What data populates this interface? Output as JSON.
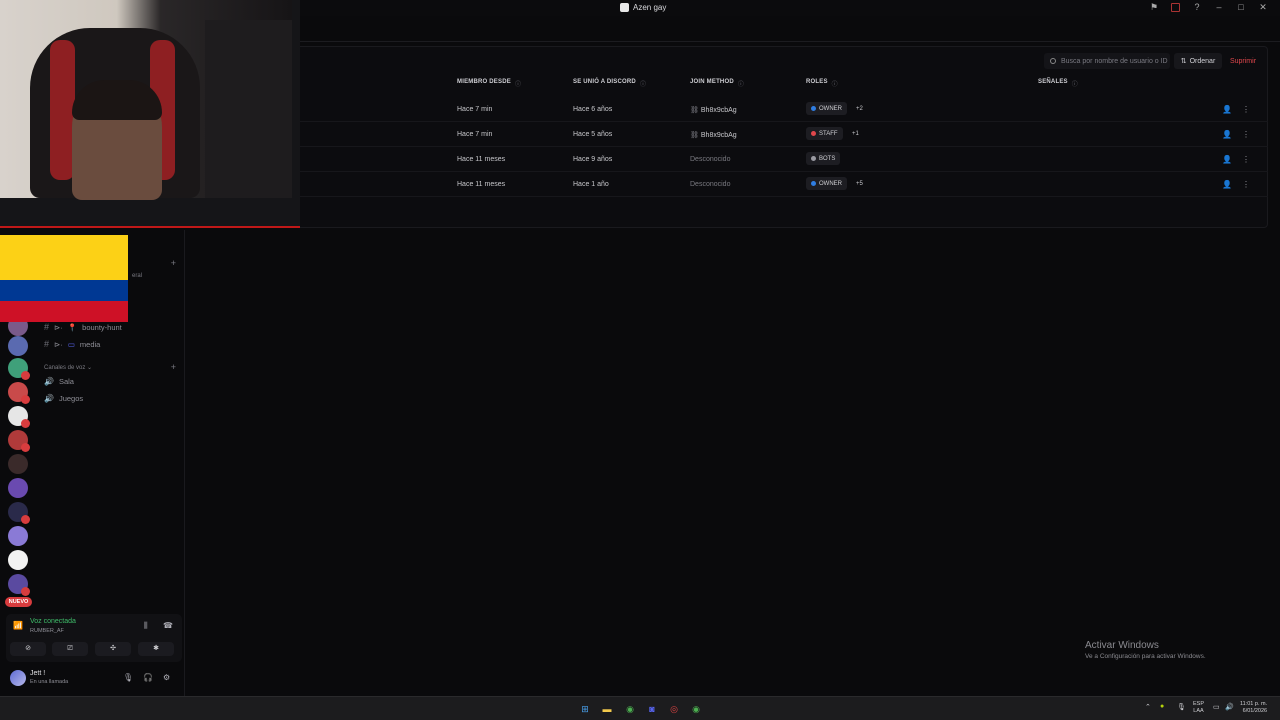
{
  "window": {
    "title": "Azen gay"
  },
  "toolbar": {
    "search_placeholder": "Busca por nombre de usuario o ID",
    "sort_label": "Ordenar",
    "delete_label": "Suprimir"
  },
  "table": {
    "headers": [
      "MIEMBRO DESDE",
      "SE UNIÓ A DISCORD",
      "JOIN METHOD",
      "ROLES",
      "SEÑALES"
    ],
    "rows": [
      {
        "member_since": "Hace 7 min",
        "joined_discord": "Hace 6 años",
        "join_method": "Bh8x9cbAg",
        "role": "OWNER",
        "role_color": "#2f7de1",
        "role_extra": "+2"
      },
      {
        "member_since": "Hace 7 min",
        "joined_discord": "Hace 5 años",
        "join_method": "Bh8x9cbAg",
        "role": "STAFF",
        "role_color": "#e0474c",
        "role_extra": "+1"
      },
      {
        "member_since": "Hace 11 meses",
        "joined_discord": "Hace 9 años",
        "join_method": "Desconocido",
        "role": "BOTS",
        "role_color": "#9a9aa2",
        "role_extra": ""
      },
      {
        "member_since": "Hace 11 meses",
        "joined_discord": "Hace 1 año",
        "join_method": "Desconocido",
        "role": "OWNER",
        "role_color": "#2f7de1",
        "role_extra": "+5"
      }
    ]
  },
  "sidebar": {
    "channels": [
      {
        "name": "bounty-hunt"
      },
      {
        "name": "media"
      }
    ],
    "voice_category": "Canales de voz",
    "voice_channels": [
      "Sala",
      "Juegos"
    ],
    "partial_label": "eral",
    "new_badge": "NUEVO"
  },
  "voice": {
    "status": "Voz conectada",
    "server": "RUMBER_AF"
  },
  "user": {
    "name": "Jett !",
    "status": "En una llamada"
  },
  "activation": {
    "title": "Activar Windows",
    "subtitle": "Ve a Configuración para activar Windows."
  },
  "taskbar": {
    "lang_top": "ESP",
    "lang_bottom": "LAA",
    "time": "11:01 p. m.",
    "date": "6/01/2026"
  },
  "icons": {
    "search": "search-icon",
    "sort": "sort-icon",
    "link": "link-icon",
    "profile": "profile-icon",
    "more": "more-icon"
  }
}
